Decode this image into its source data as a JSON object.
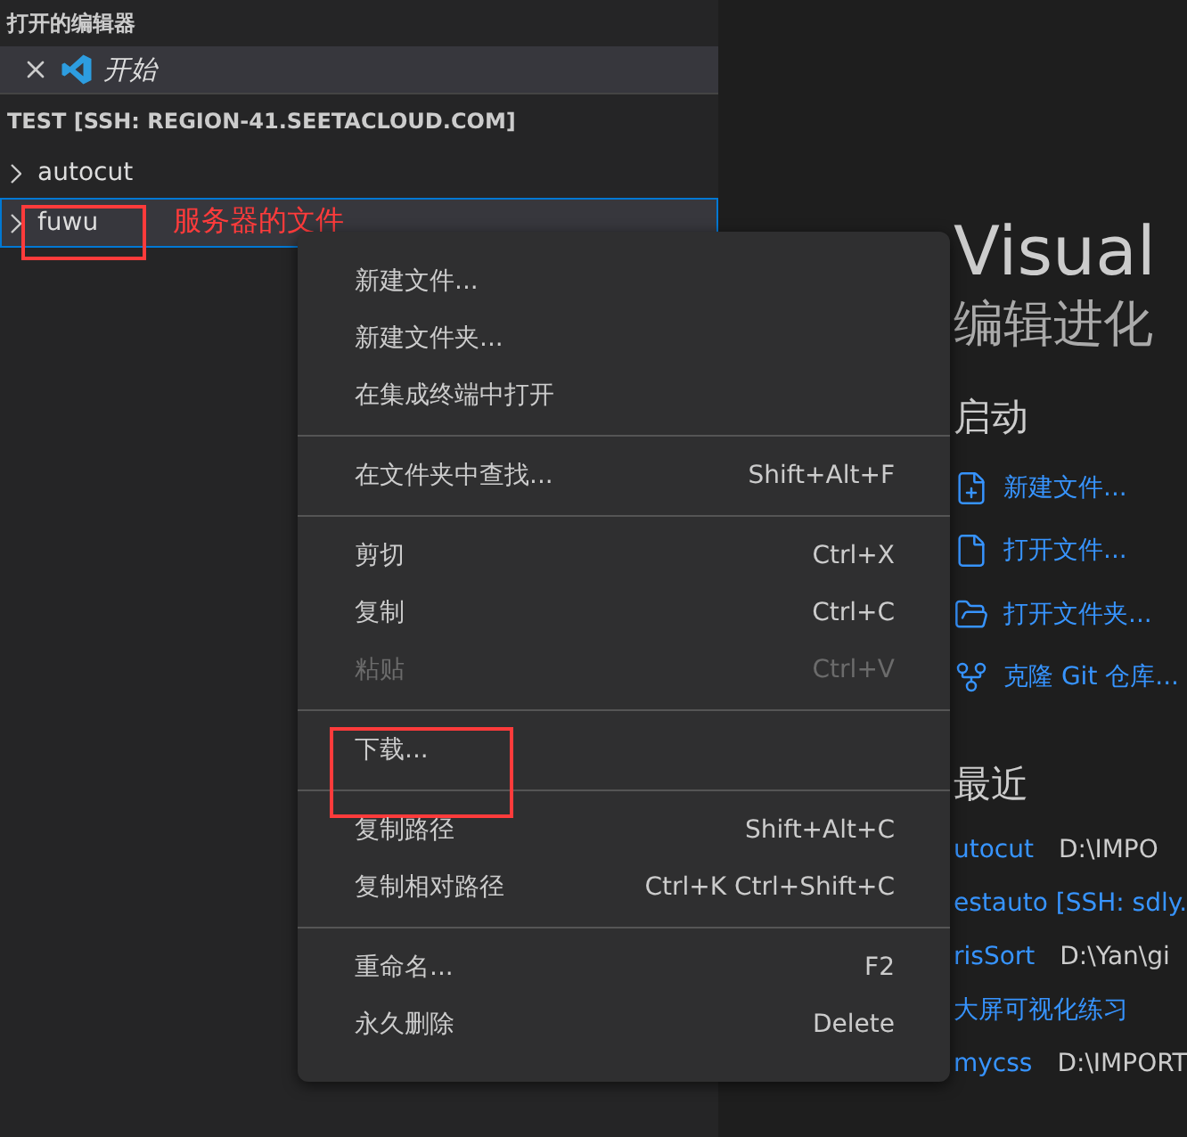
{
  "sidebar": {
    "section_title": "打开的编辑器",
    "open_editors": [
      {
        "label": "开始",
        "selected": true
      }
    ],
    "workspace_title": "TEST [SSH: REGION-41.SEETACLOUD.COM]",
    "tree": [
      {
        "name": "autocut",
        "selected": false,
        "highlighted": false
      },
      {
        "name": "fuwu",
        "selected": true,
        "highlighted": true,
        "note": "服务器的文件"
      }
    ]
  },
  "context_menu": {
    "groups": [
      {
        "items": [
          {
            "label": "新建文件...",
            "disabled": false,
            "highlighted": false
          },
          {
            "label": "新建文件夹...",
            "disabled": false,
            "highlighted": false
          },
          {
            "label": "在集成终端中打开",
            "disabled": false,
            "highlighted": false
          }
        ]
      },
      {
        "items": [
          {
            "label": "在文件夹中查找...",
            "shortcut": "Shift+Alt+F",
            "disabled": false,
            "highlighted": false
          }
        ]
      },
      {
        "items": [
          {
            "label": "剪切",
            "shortcut": "Ctrl+X",
            "disabled": false,
            "highlighted": false
          },
          {
            "label": "复制",
            "shortcut": "Ctrl+C",
            "disabled": false,
            "highlighted": false
          },
          {
            "label": "粘贴",
            "shortcut": "Ctrl+V",
            "disabled": true,
            "highlighted": false
          }
        ]
      },
      {
        "items": [
          {
            "label": "下载...",
            "disabled": false,
            "highlighted": true
          }
        ]
      },
      {
        "items": [
          {
            "label": "复制路径",
            "shortcut": "Shift+Alt+C",
            "disabled": false,
            "highlighted": false
          },
          {
            "label": "复制相对路径",
            "shortcut": "Ctrl+K Ctrl+Shift+C",
            "disabled": false,
            "highlighted": false
          }
        ]
      },
      {
        "items": [
          {
            "label": "重命名...",
            "shortcut": "F2",
            "disabled": false,
            "highlighted": false
          },
          {
            "label": "永久删除",
            "shortcut": "Delete",
            "disabled": false,
            "highlighted": false
          }
        ]
      }
    ]
  },
  "welcome": {
    "title": "Visual",
    "subtitle": "编辑进化",
    "start": {
      "heading": "启动",
      "items": [
        {
          "kind": "new-file",
          "label": "新建文件..."
        },
        {
          "kind": "open-file",
          "label": "打开文件..."
        },
        {
          "kind": "open-folder",
          "label": "打开文件夹..."
        },
        {
          "kind": "clone",
          "label": "克隆 Git 仓库..."
        }
      ]
    },
    "recent": {
      "heading": "最近",
      "items": [
        {
          "name": "utocut",
          "path": "D:\\IMPO"
        },
        {
          "name": "estauto [SSH: sdly."
        },
        {
          "name": "risSort",
          "path": "D:\\Yan\\gi"
        },
        {
          "name": "大屏可视化练习"
        },
        {
          "name": "mycss",
          "path": "D:\\IMPORT"
        }
      ]
    }
  }
}
